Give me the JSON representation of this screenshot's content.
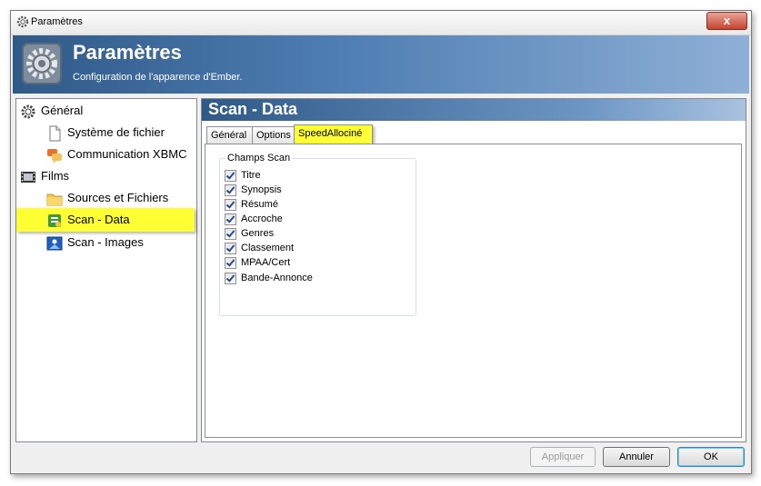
{
  "window": {
    "title": "Paramètres",
    "close_label": "x"
  },
  "banner": {
    "title": "Paramètres",
    "subtitle": "Configuration de l'apparence d'Ember."
  },
  "tree": {
    "items": [
      {
        "label": "Général",
        "icon": "gear-icon"
      },
      {
        "label": "Système de fichier",
        "icon": "document-icon"
      },
      {
        "label": "Communication XBMC",
        "icon": "chat-bubbles-icon"
      },
      {
        "label": "Films",
        "icon": "film-icon"
      },
      {
        "label": "Sources et Fichiers",
        "icon": "folder-icon"
      },
      {
        "label": "Scan - Data",
        "icon": "scan-data-icon",
        "selected": true
      },
      {
        "label": "Scan - Images",
        "icon": "image-icon"
      }
    ]
  },
  "panel": {
    "title": "Scan - Data",
    "tabs": [
      {
        "label": "Général"
      },
      {
        "label": "Options"
      },
      {
        "label": "SpeedAllociné",
        "active": true
      }
    ],
    "group": {
      "label": "Champs Scan",
      "checkboxes": [
        {
          "label": "Titre",
          "checked": true
        },
        {
          "label": "Synopsis",
          "checked": true
        },
        {
          "label": "Résumé",
          "checked": true
        },
        {
          "label": "Accroche",
          "checked": true
        },
        {
          "label": "Genres",
          "checked": true
        },
        {
          "label": "Classement",
          "checked": true
        },
        {
          "label": "MPAA/Cert",
          "checked": true
        },
        {
          "label": "Bande-Annonce",
          "checked": true
        }
      ]
    }
  },
  "footer": {
    "apply_label": "Appliquer",
    "cancel_label": "Annuler",
    "ok_label": "OK"
  },
  "colors": {
    "highlight": "#ffff33",
    "header_blue": "#2f5a88"
  }
}
